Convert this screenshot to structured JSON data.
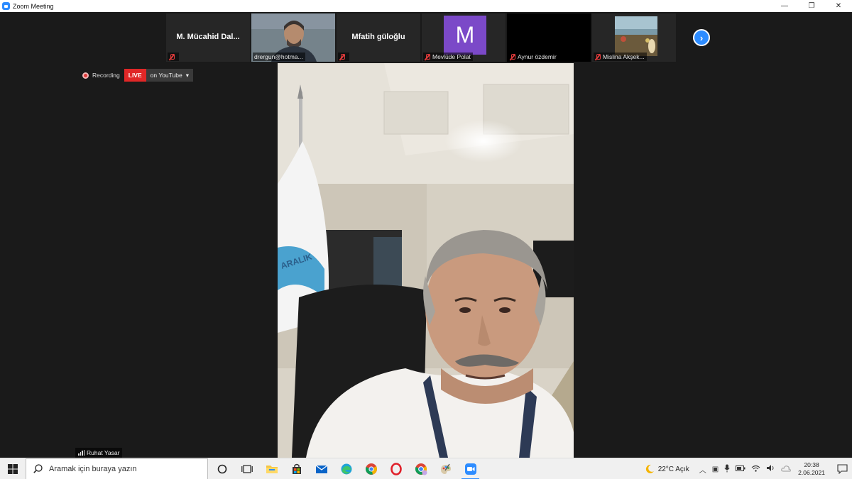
{
  "window": {
    "title": "Zoom Meeting",
    "controls": [
      "—",
      "❐",
      "✕"
    ]
  },
  "thumbnails": [
    {
      "display": "M. Mücahid  Dal..."
    },
    {
      "label": "drergun@hotma..."
    },
    {
      "display": "Mfatih güloğlu"
    },
    {
      "initial": "M",
      "label": "Mevlüde Polat"
    },
    {
      "label": "Aynur özdemir"
    },
    {
      "label": "Mislina Akşek..."
    }
  ],
  "recording": {
    "text": "Recording",
    "live": "LIVE",
    "destination": "on YouTube",
    "caret": "▾"
  },
  "main": {
    "speaker": "Ruhat Yasar",
    "flag_text": "ARALIK"
  },
  "taskbar": {
    "search_placeholder": "Aramak için buraya yazın",
    "weather": "22°C  Açık",
    "time": "20:38",
    "date": "2.06.2021"
  },
  "colors": {
    "zoom_blue": "#2d8cff",
    "live_red": "#e02727",
    "avatar_purple": "#7b49c8"
  }
}
